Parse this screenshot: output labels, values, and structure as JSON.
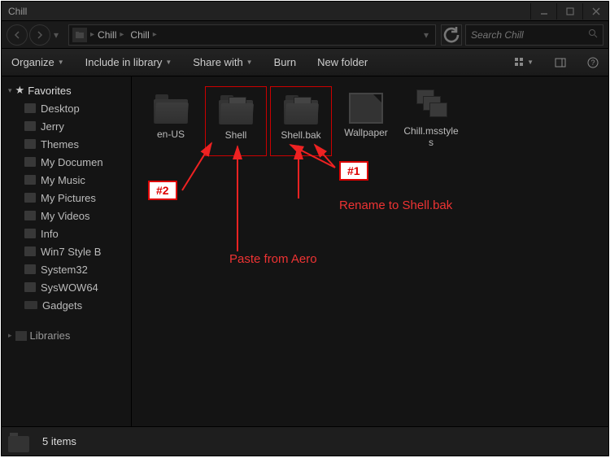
{
  "window": {
    "title": "Chill"
  },
  "breadcrumb": {
    "seg1": "Chill",
    "seg2": "Chill"
  },
  "search": {
    "placeholder": "Search Chill"
  },
  "toolbar": {
    "organize": "Organize",
    "include": "Include in library",
    "share": "Share with",
    "burn": "Burn",
    "newfolder": "New folder"
  },
  "sidebar": {
    "favorites": "Favorites",
    "items": [
      {
        "label": "Desktop"
      },
      {
        "label": "Jerry"
      },
      {
        "label": "Themes"
      },
      {
        "label": "My Documen"
      },
      {
        "label": "My Music"
      },
      {
        "label": "My Pictures"
      },
      {
        "label": "My Videos"
      },
      {
        "label": "Info"
      },
      {
        "label": "Win7 Style B"
      },
      {
        "label": "System32"
      },
      {
        "label": "SysWOW64"
      },
      {
        "label": "Gadgets"
      }
    ],
    "libraries": "Libraries"
  },
  "items": [
    {
      "label": "en-US",
      "type": "folder"
    },
    {
      "label": "Shell",
      "type": "folder"
    },
    {
      "label": "Shell.bak",
      "type": "folder"
    },
    {
      "label": "Wallpaper",
      "type": "wallpaper"
    },
    {
      "label": "Chill.msstyles",
      "type": "msstyles"
    }
  ],
  "annotations": {
    "num1": "#1",
    "num2": "#2",
    "rename": "Rename to Shell.bak",
    "paste": "Paste from Aero"
  },
  "status": {
    "count": "5 items"
  }
}
